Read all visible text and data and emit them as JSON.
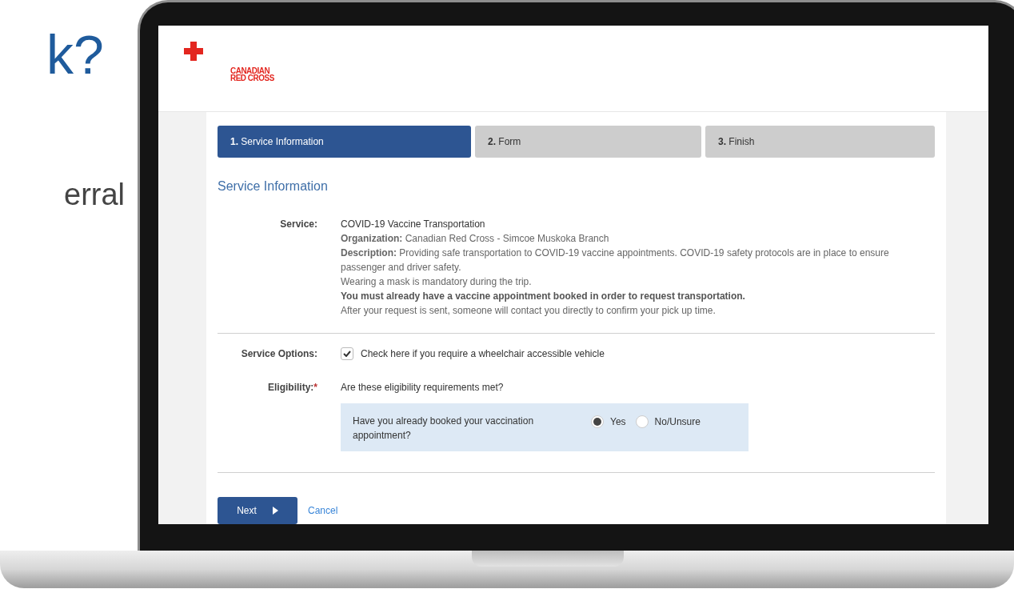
{
  "slide_text": [
    "k?",
    "erral"
  ],
  "logo": {
    "lines": [
      "CANADIAN",
      "RED CROSS"
    ]
  },
  "steps": [
    {
      "number": "1.",
      "label": "Service Information",
      "selected": true
    },
    {
      "number": "2.",
      "label": "Form",
      "selected": false
    },
    {
      "number": "3.",
      "label": "Finish",
      "selected": false
    }
  ],
  "section_title": "Service Information",
  "service": {
    "label": "Service:",
    "lines": [
      {
        "kind": "plain",
        "text": "COVID-19 Vaccine Transportation"
      },
      {
        "kind": "muted",
        "text": "**Organization:** Canadian Red Cross - Simcoe Muskoka Branch"
      },
      {
        "kind": "muted",
        "text": "**Description:** Providing safe transportation to COVID-19 vaccine appointments. COVID-19 safety protocols are in place to ensure passenger and driver safety."
      },
      {
        "kind": "muted",
        "text": "Wearing a mask is mandatory during the trip."
      },
      {
        "kind": "strong",
        "text": "You must already have a vaccine appointment booked in order to request transportation."
      },
      {
        "kind": "muted",
        "text": "After your request is sent, someone will contact you directly to confirm your pick up time."
      }
    ]
  },
  "service_options": {
    "label": "Service Options:",
    "checkbox": {
      "label": "Check here if you require a wheelchair accessible vehicle",
      "checked": true
    }
  },
  "eligibility": {
    "label": "Eligibility:",
    "required_mark": "*",
    "prompt": "Are these eligibility requirements met?",
    "question": "Have you already booked your vaccination appointment?",
    "options": [
      {
        "label": "Yes",
        "selected": true
      },
      {
        "label": "No/Unsure",
        "selected": false
      }
    ]
  },
  "buttons": {
    "next": "Next",
    "cancel": "Cancel"
  }
}
